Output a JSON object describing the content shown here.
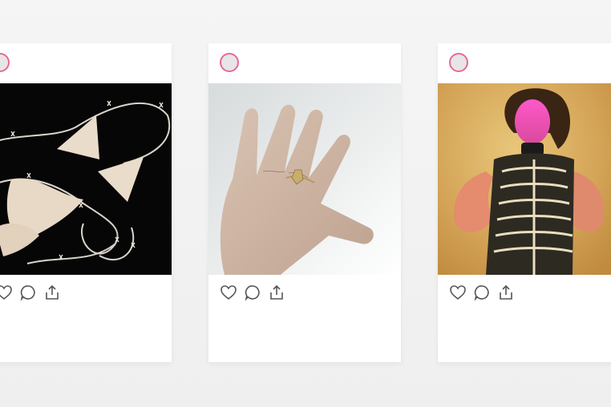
{
  "feed": {
    "posts": [
      {
        "photo_subject": "bikini-with-barbed-wire-photo",
        "actions": [
          "heart-icon",
          "comment-icon",
          "share-icon"
        ]
      },
      {
        "photo_subject": "hand-with-ring-photo",
        "actions": [
          "heart-icon",
          "comment-icon",
          "share-icon"
        ]
      },
      {
        "photo_subject": "fashion-portrait-photo",
        "actions": [
          "heart-icon",
          "comment-icon",
          "share-icon"
        ]
      }
    ]
  },
  "colors": {
    "background": "#f2f2f2",
    "card": "#ffffff",
    "avatar_ring": "#e8679b",
    "icon_stroke": "#555555"
  }
}
